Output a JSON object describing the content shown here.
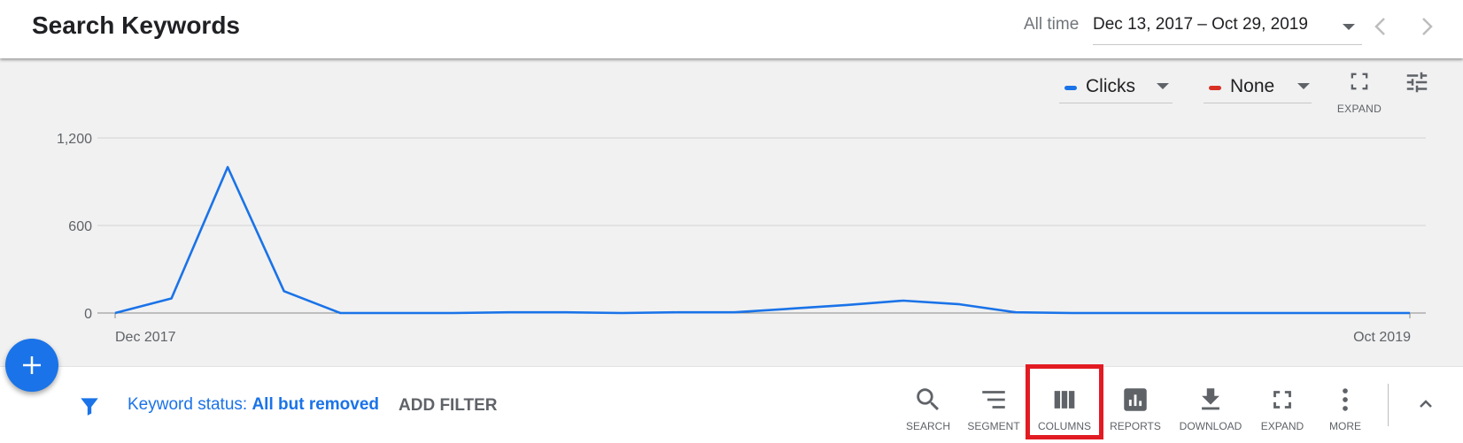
{
  "header": {
    "title": "Search Keywords",
    "date_range_label": "All time",
    "date_range_value": "Dec 13, 2017 – Oct 29, 2019"
  },
  "chart_controls": {
    "metric1": {
      "label": "Clicks",
      "color": "#1a73e8"
    },
    "metric2": {
      "label": "None",
      "color": "#d93025"
    },
    "expand_label": "EXPAND"
  },
  "chart_data": {
    "type": "line",
    "x_start_label": "Dec 2017",
    "x_end_label": "Oct 2019",
    "ylim": [
      0,
      1200
    ],
    "yticks": [
      "1,200",
      "600",
      "0"
    ],
    "grid": true,
    "series": [
      {
        "name": "Clicks",
        "color": "#1a73e8",
        "values": [
          0,
          100,
          1000,
          150,
          0,
          0,
          0,
          5,
          5,
          0,
          5,
          5,
          30,
          55,
          85,
          60,
          5,
          0,
          0,
          0,
          0,
          0,
          0,
          0
        ]
      }
    ]
  },
  "filter": {
    "key": "Keyword status:",
    "value": "All but removed",
    "add_label": "ADD FILTER"
  },
  "toolbar": {
    "search": "SEARCH",
    "segment": "SEGMENT",
    "columns": "COLUMNS",
    "reports": "REPORTS",
    "download": "DOWNLOAD",
    "expand": "EXPAND",
    "more": "MORE"
  }
}
